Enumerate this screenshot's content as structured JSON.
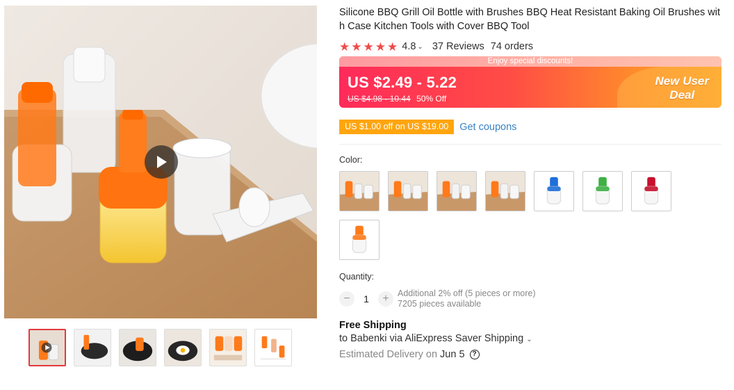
{
  "gallery": {
    "main_image_alt": "",
    "play_icon": "play-icon",
    "thumbnails": [
      {
        "kind": "video-cover",
        "active": true
      },
      {
        "kind": "pan-with-brush",
        "active": false
      },
      {
        "kind": "pan-with-bottle",
        "active": false
      },
      {
        "kind": "frying-egg",
        "active": false
      },
      {
        "kind": "product-set",
        "active": false
      },
      {
        "kind": "diagram-card",
        "active": false
      }
    ]
  },
  "product": {
    "title": "Silicone BBQ Grill Oil Bottle with Brushes BBQ Heat Resistant Baking Oil Brushes with Case Kitchen Tools with Cover BBQ Tool",
    "rating": {
      "stars": 5,
      "score": "4.8",
      "reviews": "37 Reviews",
      "orders": "74 orders"
    }
  },
  "price": {
    "banner_text": "Enjoy special discounts!",
    "current": "US $2.49 - 5.22",
    "original": "US $4.98 - 10.44",
    "discount": "50% Off",
    "badge_line1": "New User",
    "badge_line2": "Deal",
    "colors": {
      "start": "#ff2a5a",
      "end": "#ffa126"
    }
  },
  "coupon": {
    "tag": "US $1.00 off on US $19.00",
    "link": "Get coupons"
  },
  "color_option": {
    "label": "Color:",
    "swatches": [
      {
        "kind": "photo",
        "accent": "#ff7a1a"
      },
      {
        "kind": "photo",
        "accent": "#ff7a1a"
      },
      {
        "kind": "photo",
        "accent": "#ff7a1a"
      },
      {
        "kind": "photo",
        "accent": "#ff7a1a"
      },
      {
        "kind": "bottle",
        "accent": "#1e6fd9"
      },
      {
        "kind": "bottle",
        "accent": "#3cb043"
      },
      {
        "kind": "bottle",
        "accent": "#c8102e"
      },
      {
        "kind": "bottle",
        "accent": "#ff7a1a"
      }
    ]
  },
  "quantity": {
    "label": "Quantity:",
    "minus": "−",
    "value": "1",
    "plus": "+",
    "note1": "Additional 2% off (5 pieces or more)",
    "note2": "7205 pieces available"
  },
  "shipping": {
    "title": "Free Shipping",
    "line": "to Babenki via AliExpress Saver Shipping",
    "delivery_label": "Estimated Delivery on",
    "delivery_date": "Jun 5",
    "help": "?"
  }
}
